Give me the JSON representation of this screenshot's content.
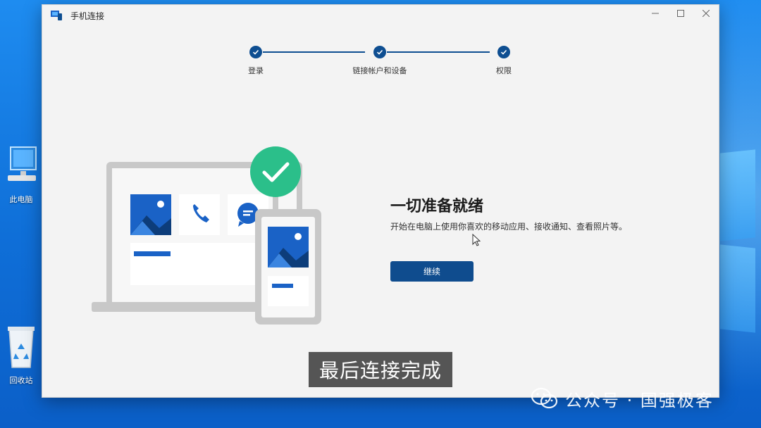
{
  "window": {
    "title": "手机连接"
  },
  "stepper": {
    "steps": [
      {
        "label": "登录"
      },
      {
        "label": "链接帐户和设备"
      },
      {
        "label": "权限"
      }
    ]
  },
  "content": {
    "heading": "一切准备就绪",
    "description": "开始在电脑上使用你喜欢的移动应用、接收通知、查看照片等。",
    "continue_label": "继续"
  },
  "desktop": {
    "icons": [
      {
        "label": "此电脑"
      },
      {
        "label": "回收站"
      }
    ]
  },
  "overlay": {
    "subtitle": "最后连接完成",
    "watermark": "公众号 · 国强极客"
  },
  "colors": {
    "accent": "#0f4c8e",
    "success_green": "#2bbf8a",
    "illustration_blue": "#1a62c6"
  }
}
